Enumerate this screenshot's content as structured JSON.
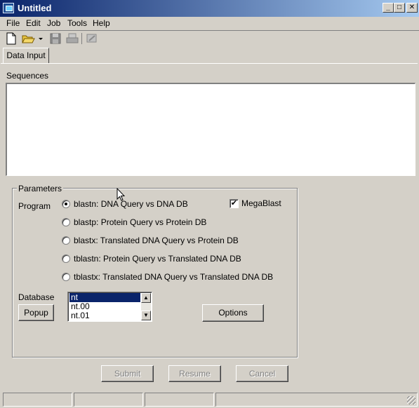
{
  "window": {
    "title": "Untitled"
  },
  "menu": [
    "File",
    "Edit",
    "Job",
    "Tools",
    "Help"
  ],
  "toolbar": {
    "icons": [
      "new-document-icon",
      "open-folder-icon",
      "dropdown-arrow-icon",
      "save-icon",
      "print-icon",
      "run-icon"
    ]
  },
  "tabs": [
    {
      "label": "Data Input",
      "active": true
    }
  ],
  "sequences": {
    "label": "Sequences",
    "value": ""
  },
  "parameters": {
    "title": "Parameters",
    "program_label": "Program",
    "programs": [
      {
        "label": "blastn: DNA Query vs DNA DB",
        "checked": true
      },
      {
        "label": "blastp: Protein Query vs Protein DB",
        "checked": false
      },
      {
        "label": "blastx: Translated DNA Query vs Protein DB",
        "checked": false
      },
      {
        "label": "tblastn: Protein Query vs Translated DNA DB",
        "checked": false
      },
      {
        "label": "tblastx: Translated DNA Query vs Translated DNA DB",
        "checked": false
      }
    ],
    "megablast": {
      "label": "MegaBlast",
      "checked": true
    },
    "database_label": "Database",
    "popup_label": "Popup",
    "database_options": [
      "nt",
      "nt.00",
      "nt.01"
    ],
    "selected_database": "nt",
    "options_label": "Options"
  },
  "actions": {
    "submit": "Submit",
    "resume": "Resume",
    "cancel": "Cancel"
  }
}
